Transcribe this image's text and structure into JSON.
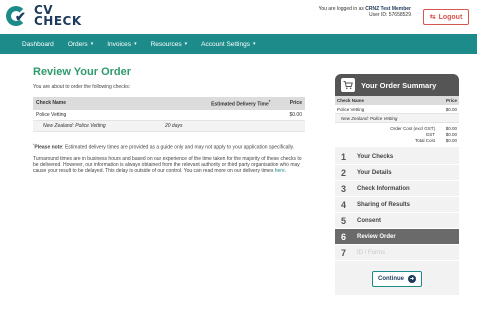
{
  "logo": {
    "line1": "CV",
    "line2": "CHECK"
  },
  "login": {
    "prefix": "You are logged in as",
    "member": "CRNZ Test Member",
    "user_id": "User ID: 57658529"
  },
  "logout_label": "Logout",
  "nav": [
    {
      "label": "Dashboard",
      "dropdown": false
    },
    {
      "label": "Orders",
      "dropdown": true
    },
    {
      "label": "Invoices",
      "dropdown": true
    },
    {
      "label": "Resources",
      "dropdown": true
    },
    {
      "label": "Account Settings",
      "dropdown": true
    }
  ],
  "page": {
    "title": "Review Your Order",
    "intro": "You are about to order the following checks:",
    "table": {
      "headers": {
        "name": "Check Name",
        "delivery": "Estimated Delivery Time",
        "price": "Price"
      },
      "row": {
        "name": "Police Vetting",
        "delivery": "",
        "price": "$0.00"
      },
      "sub": {
        "name": "New Zealand: Police Vetting",
        "delivery": "20 days",
        "price": ""
      }
    },
    "note_bold": "Please note",
    "note_text": ": Estimated delivery times are provided as a guide only and may not apply to your application specifically.",
    "body": "Turnaround times are in business hours and based on our experience of the time taken for the majority of these checks to be delivered. However, our information is always obtained from the relevant authority or third party organisation who may cause your result to be delayed. This delay is outside of our control. You can read more on our delivery times ",
    "body_link": "here",
    "body_end": "."
  },
  "summary": {
    "title": "Your Order Summary",
    "headers": {
      "name": "Check Name",
      "price": "Price"
    },
    "row": {
      "name": "Police Vetting",
      "price": "$0.00"
    },
    "sub": {
      "name": "New Zealand: Police Vetting"
    },
    "costs": [
      {
        "label": "Order Cost (excl GST)",
        "value": "$0.00"
      },
      {
        "label": "GST",
        "value": "$0.00"
      },
      {
        "label": "Total Cost",
        "value": "$0.00"
      }
    ],
    "steps": [
      {
        "num": "1",
        "label": "Your Checks",
        "state": "done"
      },
      {
        "num": "2",
        "label": "Your Details",
        "state": "done"
      },
      {
        "num": "3",
        "label": "Check Information",
        "state": "done"
      },
      {
        "num": "4",
        "label": "Sharing of Results",
        "state": "done"
      },
      {
        "num": "5",
        "label": "Consent",
        "state": "done"
      },
      {
        "num": "6",
        "label": "Review Order",
        "state": "active"
      },
      {
        "num": "7",
        "label": "ID / Forms",
        "state": "disabled"
      }
    ],
    "continue_label": "Continue"
  },
  "colors": {
    "teal": "#1e8b8b",
    "navy": "#1e3a5c",
    "green_title": "#2e9a6e",
    "logout_red": "#d9534f"
  }
}
